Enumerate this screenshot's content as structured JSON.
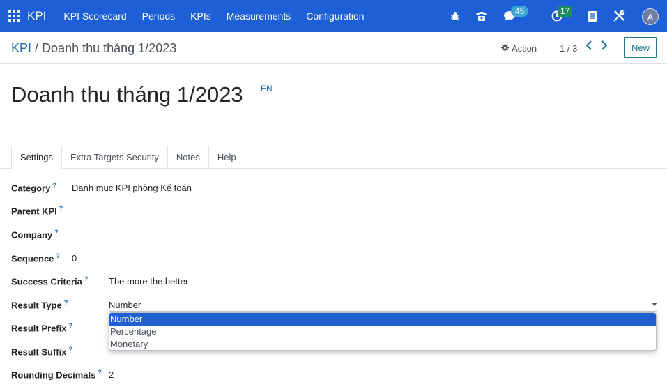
{
  "navbar": {
    "brand": "KPI",
    "menu": [
      "KPI Scorecard",
      "Periods",
      "KPIs",
      "Measurements",
      "Configuration"
    ],
    "messages_count": "45",
    "activities_count": "17",
    "avatar_letter": "A",
    "color": "#1d5fd6"
  },
  "control": {
    "breadcrumb_parent": "KPI",
    "breadcrumb_sep": "/",
    "breadcrumb_current": "Doanh thu tháng 1/2023",
    "action_label": "Action",
    "pager": "1 / 3",
    "new_label": "New"
  },
  "record": {
    "title": "Doanh thu tháng 1/2023",
    "lang": "EN"
  },
  "tabs": [
    "Settings",
    "Extra Targets Security",
    "Notes",
    "Help"
  ],
  "fields": {
    "category": {
      "label": "Category",
      "value": "Danh mục KPI phòng Kế toán"
    },
    "parent_kpi": {
      "label": "Parent KPI",
      "value": ""
    },
    "company": {
      "label": "Company",
      "value": ""
    },
    "sequence": {
      "label": "Sequence",
      "value": "0"
    },
    "success_criteria": {
      "label": "Success Criteria",
      "value": "The more the better"
    },
    "result_type": {
      "label": "Result Type",
      "value": "Number"
    },
    "result_prefix": {
      "label": "Result Prefix",
      "value": ""
    },
    "result_suffix": {
      "label": "Result Suffix",
      "value": ""
    },
    "rounding_decimals": {
      "label": "Rounding Decimals",
      "value": "2"
    }
  },
  "help_mark": "?",
  "dropdown_options": [
    "Number",
    "Percentage",
    "Monetary"
  ],
  "icons": [
    "apps-icon",
    "bug-icon",
    "phone-icon",
    "chat-icon",
    "clock-icon",
    "document-icon",
    "tools-icon",
    "gear-icon",
    "chevron-left-icon",
    "chevron-right-icon",
    "caret-down-icon"
  ]
}
